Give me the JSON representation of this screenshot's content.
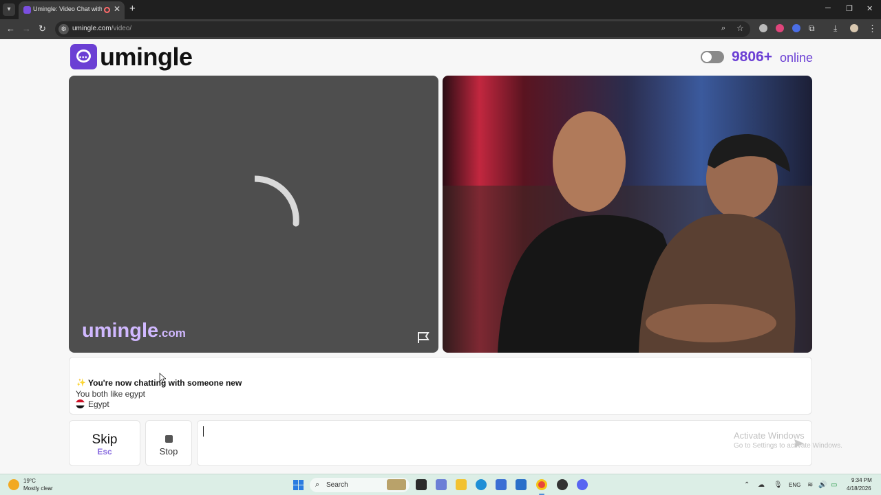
{
  "browser": {
    "tab_title": "Umingle: Video Chat with S",
    "url_host": "umingle.com",
    "url_path": "/video/"
  },
  "header": {
    "logo_text": "umingle",
    "online_count": "9806+",
    "online_label": "online"
  },
  "video": {
    "watermark_main": "umingle",
    "watermark_suffix": ".com"
  },
  "chat": {
    "headline": "You're now chatting with someone new",
    "common_interest": "You both like egypt",
    "country": "Egypt"
  },
  "controls": {
    "skip_label": "Skip",
    "skip_key": "Esc",
    "stop_label": "Stop",
    "message_value": ""
  },
  "watermark_os": {
    "title": "Activate Windows",
    "subtitle": "Go to Settings to activate Windows."
  },
  "taskbar": {
    "weather_temp": "19°C",
    "weather_condition": "Mostly clear",
    "search_label": "Search",
    "language": "ENG",
    "time": "9:34 PM",
    "date": "4/18/2026"
  },
  "colors": {
    "brand": "#6b3fd4",
    "brand_light": "#d0b8ff",
    "chrome_dark": "#1f1f1f"
  }
}
